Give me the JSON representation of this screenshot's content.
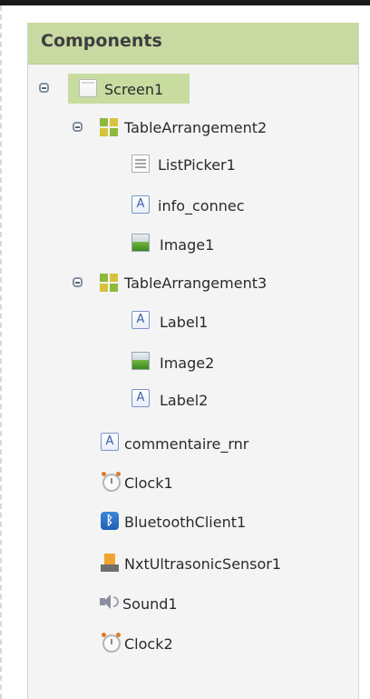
{
  "panel": {
    "title": "Components",
    "accent_color": "#c8d9a2"
  },
  "tree": {
    "screen1": {
      "label": "Screen1",
      "icon": "screen-icon"
    },
    "tablearrangement2": {
      "label": "TableArrangement2",
      "icon": "table-arrangement-icon"
    },
    "listpicker1": {
      "label": "ListPicker1",
      "icon": "list-picker-icon"
    },
    "info_connec": {
      "label": "info_connec",
      "icon": "label-icon"
    },
    "image1": {
      "label": "Image1",
      "icon": "image-icon"
    },
    "tablearrangement3": {
      "label": "TableArrangement3",
      "icon": "table-arrangement-icon"
    },
    "label1": {
      "label": "Label1",
      "icon": "label-icon"
    },
    "image2": {
      "label": "Image2",
      "icon": "image-icon"
    },
    "label2": {
      "label": "Label2",
      "icon": "label-icon"
    },
    "commentaire_rnr": {
      "label": "commentaire_rnr",
      "icon": "label-icon"
    },
    "clock1": {
      "label": "Clock1",
      "icon": "clock-icon"
    },
    "bluetoothclient1": {
      "label": "BluetoothClient1",
      "icon": "bluetooth-icon"
    },
    "nxtultrasonicsensor1": {
      "label": "NxtUltrasonicSensor1",
      "icon": "ultrasonic-sensor-icon"
    },
    "sound1": {
      "label": "Sound1",
      "icon": "sound-icon"
    },
    "clock2": {
      "label": "Clock2",
      "icon": "clock-icon"
    }
  },
  "icons": {
    "label_glyph": "A",
    "bluetooth_glyph": "ᛒ"
  }
}
